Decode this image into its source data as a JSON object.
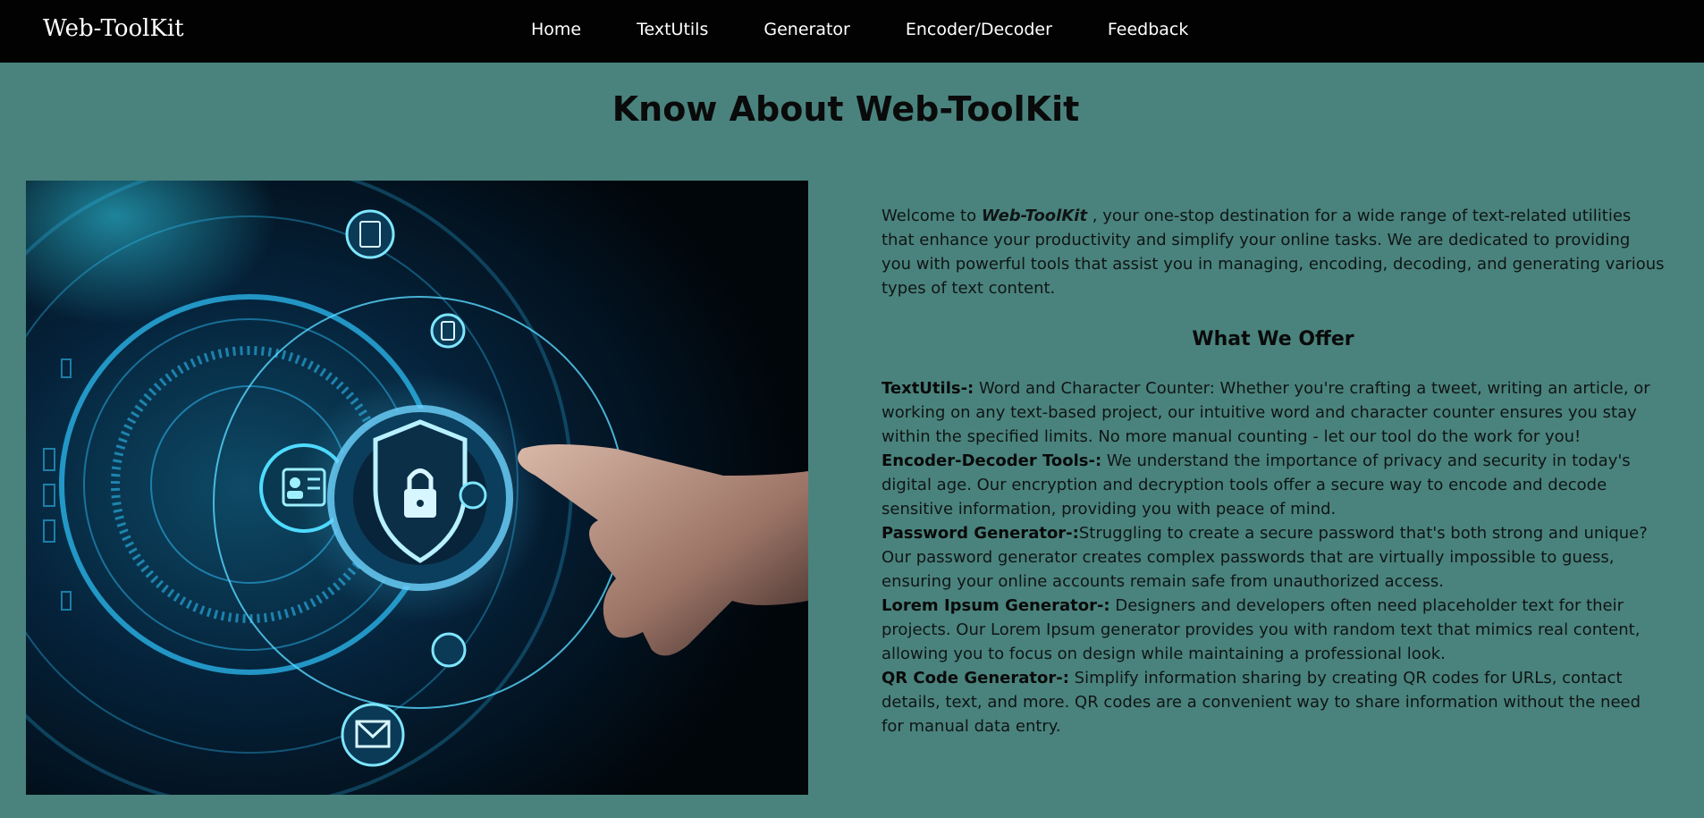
{
  "navbar": {
    "brand": "Web-ToolKit",
    "links": [
      "Home",
      "TextUtils",
      "Generator",
      "Encoder/Decoder",
      "Feedback"
    ]
  },
  "main": {
    "title": "Know About Web-ToolKit",
    "intro": {
      "prefix": "Welcome to ",
      "brand": "Web-ToolKit",
      "suffix": " , your one-stop destination for a wide range of text-related utilities that enhance your productivity and simplify your online tasks. We are dedicated to providing you with powerful tools that assist you in managing, encoding, decoding, and generating various types of text content."
    },
    "offer_heading": "What We Offer",
    "offers": [
      {
        "title": "TextUtils-:",
        "text": " Word and Character Counter: Whether you're crafting a tweet, writing an article, or working on any text-based project, our intuitive word and character counter ensures you stay within the specified limits. No more manual counting - let our tool do the work for you!"
      },
      {
        "title": "Encoder-Decoder Tools-:",
        "text": " We understand the importance of privacy and security in today's digital age. Our encryption and decryption tools offer a secure way to encode and decode sensitive information, providing you with peace of mind."
      },
      {
        "title": "Password Generator-:",
        "text": "Struggling to create a secure password that's both strong and unique? Our password generator creates complex passwords that are virtually impossible to guess, ensuring your online accounts remain safe from unauthorized access."
      },
      {
        "title": "Lorem Ipsum Generator-:",
        "text": " Designers and developers often need placeholder text for their projects. Our Lorem Ipsum generator provides you with random text that mimics real content, allowing you to focus on design while maintaining a professional look."
      },
      {
        "title": "QR Code Generator-:",
        "text": " Simplify information sharing by creating QR codes for URLs, contact details, text, and more. QR codes are a convenient way to share information without the need for manual data entry."
      }
    ]
  },
  "image": {
    "icon": "cybersecurity-hand-touch-illustration"
  },
  "colors": {
    "navbar_bg": "#020202",
    "page_bg": "#4a837d",
    "accent_cyan": "#2fc6ff"
  }
}
